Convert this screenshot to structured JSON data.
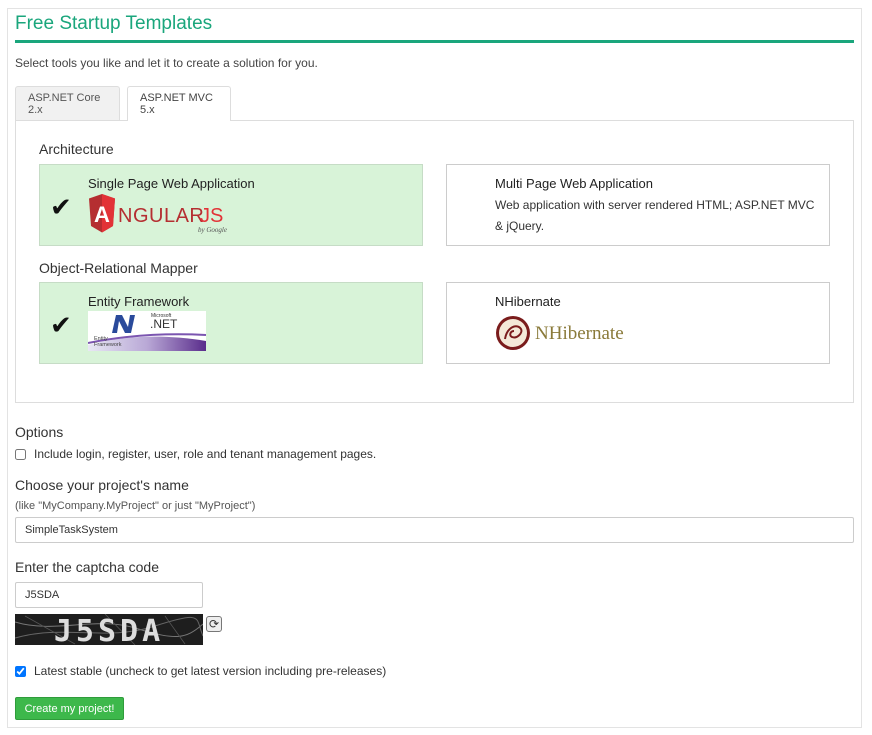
{
  "page": {
    "title": "Free Startup Templates",
    "subtitle": "Select tools you like and let it to create a solution for you."
  },
  "tabs": [
    {
      "label": "ASP.NET Core 2.x",
      "active": false
    },
    {
      "label": "ASP.NET MVC 5.x",
      "active": true
    }
  ],
  "architecture": {
    "label": "Architecture",
    "options": [
      {
        "title": "Single Page Web Application",
        "selected": true,
        "logo": "angularjs-logo",
        "logo_text": "ANGULARJS",
        "logo_sub": "by Google"
      },
      {
        "title": "Multi Page Web Application",
        "selected": false,
        "description": "Web application with server rendered HTML; ASP.NET MVC & jQuery."
      }
    ]
  },
  "orm": {
    "label": "Object-Relational Mapper",
    "options": [
      {
        "title": "Entity Framework",
        "selected": true,
        "logo": "entity-framework-logo",
        "logo_text": ".NET",
        "logo_small": "Microsoft",
        "logo_sub": "Entity Framework"
      },
      {
        "title": "NHibernate",
        "selected": false,
        "logo": "nhibernate-logo",
        "logo_text": "NHibernate"
      }
    ]
  },
  "options": {
    "label": "Options",
    "include_pages": {
      "label": "Include login, register, user, role and tenant management pages.",
      "checked": false
    }
  },
  "project_name": {
    "label": "Choose your project's name",
    "hint": "(like \"MyCompany.MyProject\" or just \"MyProject\")",
    "value": "SimpleTaskSystem"
  },
  "captcha": {
    "label": "Enter the captcha code",
    "value": "J5SDA",
    "image_text": "J5SDA"
  },
  "latest_stable": {
    "label": "Latest stable (uncheck to get latest version including pre-releases)",
    "checked": true
  },
  "create_button": {
    "label": "Create my project!"
  },
  "colors": {
    "accent": "#1aa67c",
    "selected_card": "#d8f3d8",
    "button": "#3db84b"
  }
}
